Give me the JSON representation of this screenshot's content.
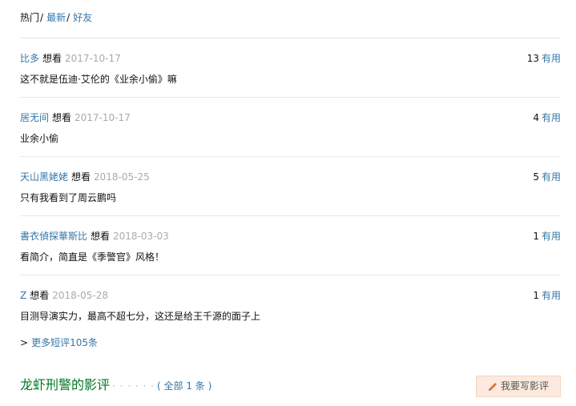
{
  "tabs": {
    "hot": "热门",
    "latest": "最新",
    "friends": "好友",
    "separator": "/"
  },
  "comments": [
    {
      "user": "比多",
      "status": "想看",
      "date": "2017-10-17",
      "votes": "13",
      "useful": "有用",
      "text": "这不就是伍迪·艾伦的《业余小偷》嘛"
    },
    {
      "user": "居无间",
      "status": "想看",
      "date": "2017-10-17",
      "votes": "4",
      "useful": "有用",
      "text": "业余小偷"
    },
    {
      "user": "天山黑姥姥",
      "status": "想看",
      "date": "2018-05-25",
      "votes": "5",
      "useful": "有用",
      "text": "只有我看到了周云鹏吗"
    },
    {
      "user": "書衣偵探華斯比",
      "status": "想看",
      "date": "2018-03-03",
      "votes": "1",
      "useful": "有用",
      "text": "看简介，简直是《季警官》风格！"
    },
    {
      "user": "Z",
      "status": "想看",
      "date": "2018-05-28",
      "votes": "1",
      "useful": "有用",
      "text": "目测导演实力，最高不超七分，这还是给王千源的面子上"
    }
  ],
  "more": {
    "arrow": ">",
    "label": "更多短评105条"
  },
  "reviews": {
    "title": "龙虾刑警的影评",
    "dots": "· · · · · ·",
    "paren_open": "(",
    "total_label": "全部 1 条",
    "paren_close": ")",
    "write_button": "我要写影评",
    "write_icon": "pencil-icon"
  },
  "colors": {
    "link": "#3377aa",
    "date": "#aaaaaa",
    "review_title": "#007722",
    "write_button_bg": "#fbeadd",
    "pencil": "#e0733b"
  }
}
